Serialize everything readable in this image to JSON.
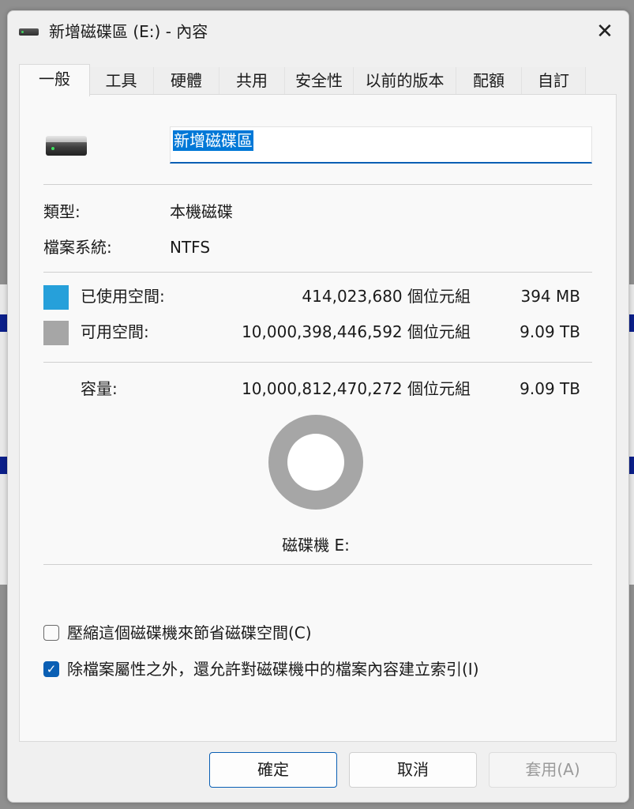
{
  "window": {
    "title": "新增磁碟區 (E:) - 內容",
    "close_glyph": "✕"
  },
  "tabs": [
    "一般",
    "工具",
    "硬體",
    "共用",
    "安全性",
    "以前的版本",
    "配額",
    "自訂"
  ],
  "active_tab": "一般",
  "general": {
    "volume_name": "新增磁碟區",
    "type_label": "類型:",
    "type_value": "本機磁碟",
    "fs_label": "檔案系統:",
    "fs_value": "NTFS",
    "used": {
      "label": "已使用空間:",
      "bytes": "414,023,680 個位元組",
      "size": "394 MB",
      "color": "#26a0da"
    },
    "free": {
      "label": "可用空間:",
      "bytes": "10,000,398,446,592 個位元組",
      "size": "9.09 TB",
      "color": "#a6a6a6"
    },
    "capacity": {
      "label": "容量:",
      "bytes": "10,000,812,470,272 個位元組",
      "size": "9.09 TB"
    },
    "drive_caption": "磁碟機 E:",
    "used_fraction": 4.14e-05
  },
  "options": {
    "compress": {
      "label": "壓縮這個磁碟機來節省磁碟空間(C)",
      "checked": false
    },
    "index": {
      "label": "除檔案屬性之外，還允許對磁碟機中的檔案內容建立索引(I)",
      "checked": true,
      "check_glyph": "✓"
    }
  },
  "buttons": {
    "ok": "確定",
    "cancel": "取消",
    "apply": "套用(A)"
  }
}
